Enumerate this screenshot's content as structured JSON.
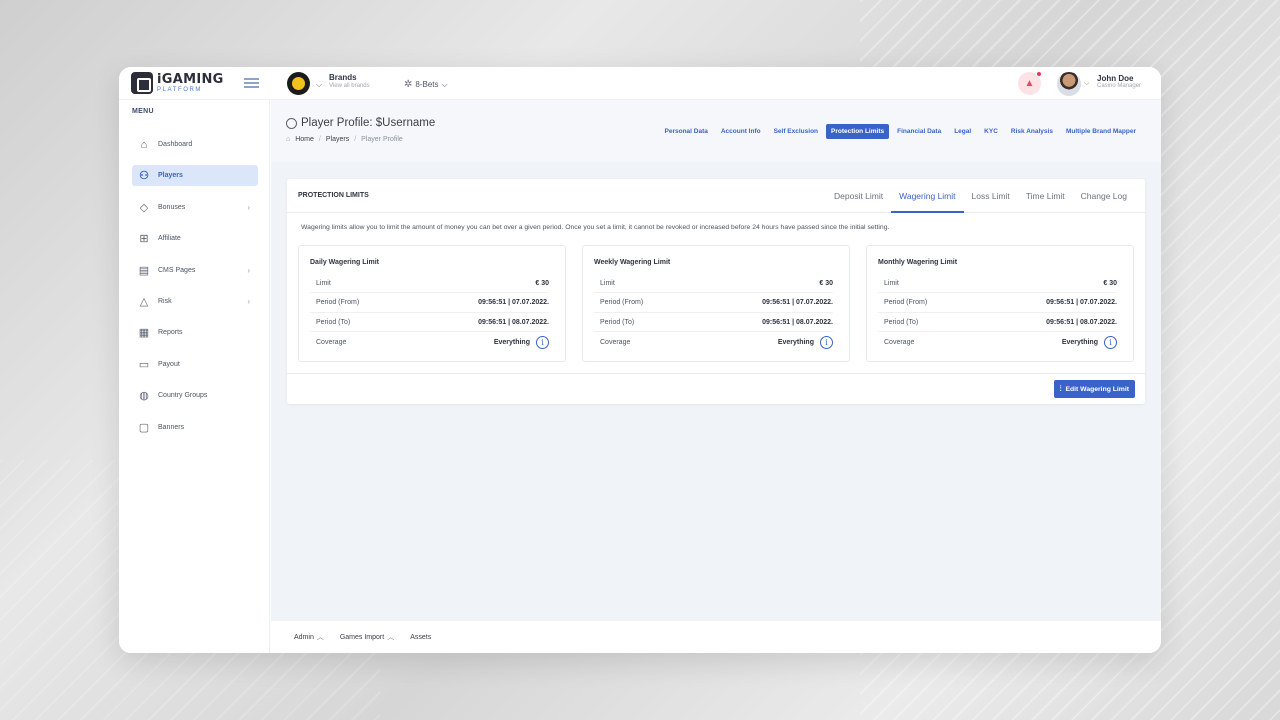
{
  "app": {
    "logo_title": "iGAMING",
    "logo_sub": "PLATFORM"
  },
  "topbar": {
    "brands_title": "Brands",
    "brands_sub": "View all brands",
    "bets_label": "8-Bets",
    "user_name": "John Doe",
    "user_role": "Casino Manager"
  },
  "sidebar": {
    "menu_label": "MENU",
    "items": [
      {
        "label": "Dashboard",
        "icon": "home-icon",
        "glyph": "⌂",
        "chevron": false,
        "active": false
      },
      {
        "label": "Players",
        "icon": "players-icon",
        "glyph": "⚇",
        "chevron": false,
        "active": true
      },
      {
        "label": "Bonuses",
        "icon": "diamond-icon",
        "glyph": "◇",
        "chevron": true,
        "active": false
      },
      {
        "label": "Affiliate",
        "icon": "hierarchy-icon",
        "glyph": "⊞",
        "chevron": false,
        "active": false
      },
      {
        "label": "CMS Pages",
        "icon": "cms-icon",
        "glyph": "▤",
        "chevron": true,
        "active": false
      },
      {
        "label": "Risk",
        "icon": "warning-icon",
        "glyph": "△",
        "chevron": true,
        "active": false
      },
      {
        "label": "Reports",
        "icon": "reports-icon",
        "glyph": "▦",
        "chevron": false,
        "active": false
      },
      {
        "label": "Payout",
        "icon": "wallet-icon",
        "glyph": "▭",
        "chevron": false,
        "active": false
      },
      {
        "label": "Country Groups",
        "icon": "globe-icon",
        "glyph": "◍",
        "chevron": false,
        "active": false
      },
      {
        "label": "Banners",
        "icon": "banner-icon",
        "glyph": "▢",
        "chevron": false,
        "active": false
      }
    ]
  },
  "page": {
    "title": "Player Profile: $Username",
    "breadcrumb": {
      "home": "Home",
      "players": "Players",
      "current": "Player Profile"
    },
    "profile_tabs": [
      "Personal Data",
      "Account Info",
      "Self Exclusion",
      "Protection Limits",
      "Financial Data",
      "Legal",
      "KYC",
      "Risk Analysis",
      "Multiple Brand Mapper"
    ],
    "active_profile_tab": "Protection Limits"
  },
  "card": {
    "title": "PROTECTION LIMITS",
    "limit_tabs": [
      "Deposit Limit",
      "Wagering Limit",
      "Loss Limit",
      "Time Limit",
      "Change Log"
    ],
    "active_limit_tab": "Wagering Limit",
    "description": "Wagering limits allow you to limit the amount of money you can bet over a given period. Once you set a limit, it cannot be revoked or increased before 24 hours have passed since the initial setting.",
    "boxes": [
      {
        "title": "Daily Wagering Limit",
        "rows": [
          [
            "Limit",
            "€ 30"
          ],
          [
            "Period (From)",
            "09:56:51 | 07.07.2022."
          ],
          [
            "Period (To)",
            "09:56:51 | 08.07.2022."
          ],
          [
            "Coverage",
            "Everything"
          ]
        ]
      },
      {
        "title": "Weekly Wagering Limit",
        "rows": [
          [
            "Limit",
            "€ 30"
          ],
          [
            "Period (From)",
            "09:56:51 | 07.07.2022."
          ],
          [
            "Period (To)",
            "09:56:51 | 08.07.2022."
          ],
          [
            "Coverage",
            "Everything"
          ]
        ]
      },
      {
        "title": "Monthly Wagering Limit",
        "rows": [
          [
            "Limit",
            "€ 30"
          ],
          [
            "Period (From)",
            "09:56:51 | 07.07.2022."
          ],
          [
            "Period (To)",
            "09:56:51 | 08.07.2022."
          ],
          [
            "Coverage",
            "Everything"
          ]
        ]
      }
    ],
    "edit_button": "Edit Wagering Limit"
  },
  "footer": {
    "items": [
      "Admin",
      "Games Import",
      "Assets"
    ]
  },
  "colors": {
    "accent": "#3a63c9",
    "active_bg": "#dbe6fb"
  }
}
